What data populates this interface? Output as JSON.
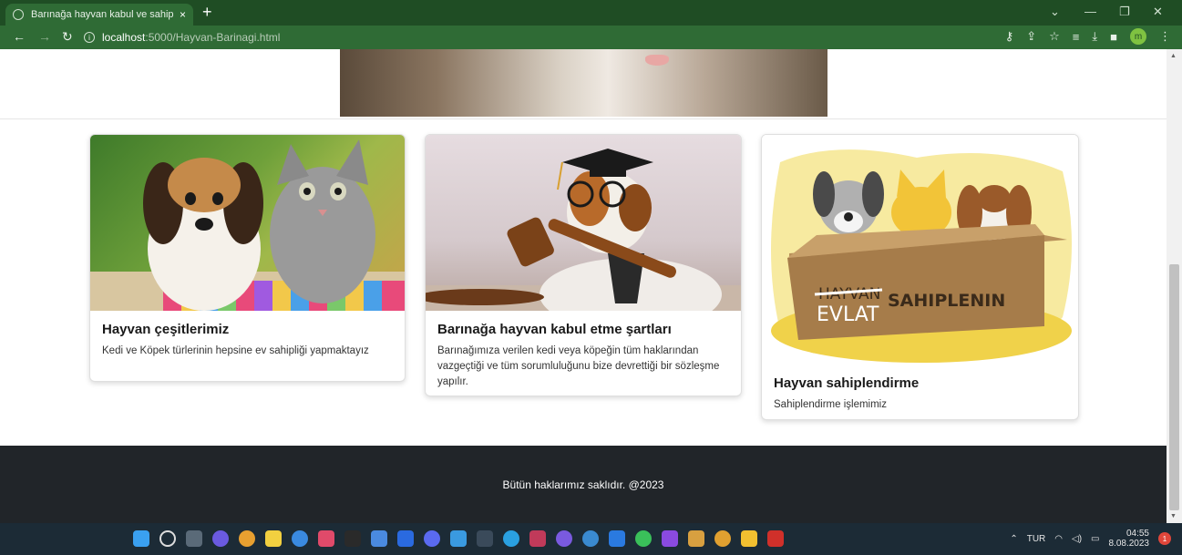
{
  "browser": {
    "tab_title": "Barınağa hayvan kabul ve sahiple",
    "tab_close": "×",
    "new_tab": "+",
    "url_host": "localhost",
    "url_path": ":5000/Hayvan-Barinagi.html",
    "profile_initial": "m"
  },
  "cards": [
    {
      "title": "Hayvan çeşitlerimiz",
      "text": "Kedi ve Köpek türlerinin hepsine ev sahipliği yapmaktayız"
    },
    {
      "title": "Barınağa hayvan kabul etme şartları",
      "text": "Barınağımıza verilen kedi veya köpeğin tüm haklarından vazgeçtiği ve tüm sorumluluğunu bize devrettiği bir sözleşme yapılır."
    },
    {
      "title": "Hayvan sahiplendirme",
      "text": "Sahiplendirme işlemimiz",
      "image_text_strike": "HAYVAN",
      "image_text_overlay": "EVLAT",
      "image_text_main": "SAHIPLENIN"
    }
  ],
  "footer": {
    "text": "Bütün haklarımız saklıdır. @2023"
  },
  "taskbar": {
    "language": "TUR",
    "time": "04:55",
    "date": "8.08.2023",
    "notification_count": "1"
  }
}
